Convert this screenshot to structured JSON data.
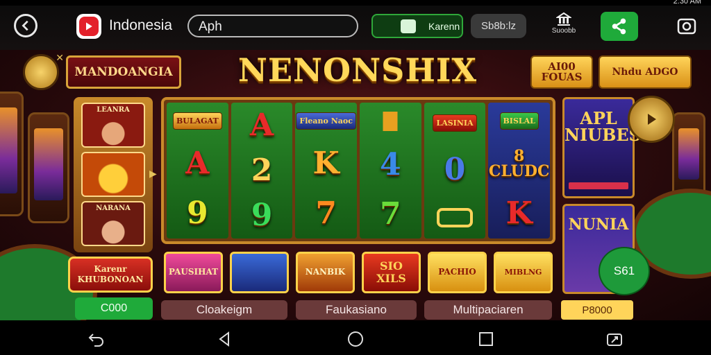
{
  "status": {
    "time": "2:30 AM"
  },
  "header": {
    "title": "Indonesia",
    "search_value": "Aph",
    "green_pill_label": "Karenn",
    "grey_pill_label": "Sb8b:lz",
    "support_label": "Suoobb"
  },
  "game": {
    "region_banner": "MANDOANGIA",
    "title": "NENONSHIX",
    "bonus_1": "AI00 FOUAS",
    "bonus_2": "Nhdu ADGO",
    "left_tiles": [
      "LEANRA",
      "",
      "NARANA"
    ],
    "left_button": "Karenr KHUBONOAN",
    "left_coin": "C000",
    "reels": [
      [
        "BULAGAT",
        "A",
        "9"
      ],
      [
        "A",
        "2",
        "9"
      ],
      [
        "Fleano Naoc",
        "K",
        "7"
      ],
      [
        "",
        "4",
        "7"
      ],
      [
        "LASINIA",
        "0",
        ""
      ],
      [
        "BISLAL",
        "8 CLUDC",
        "K"
      ]
    ],
    "game_tiles": [
      "PAUSIHAT",
      "",
      "NANBIK",
      "SIO XILS",
      "PACHIO",
      "MIBLNG"
    ],
    "tabs": [
      "Cloakeigm",
      "Faukasiano",
      "Multipaciaren"
    ],
    "price": "P8000",
    "promo_1": "APL NIUBES",
    "promo_2": "NUNIA",
    "fab_label": "S61"
  },
  "colors": {
    "accent_gold": "#ffd45a",
    "accent_green": "#1faa3a",
    "bg_red": "#5a1418"
  },
  "icons": {
    "back": "back-arrow-icon",
    "app": "play-logo-icon",
    "support": "bank-icon",
    "share": "share-icon",
    "camera": "camera-icon",
    "compass": "compass-icon",
    "play": "play-icon"
  },
  "navbar": {
    "items": [
      "back",
      "home-triangle",
      "home-circle",
      "recents",
      "screenshot"
    ]
  }
}
